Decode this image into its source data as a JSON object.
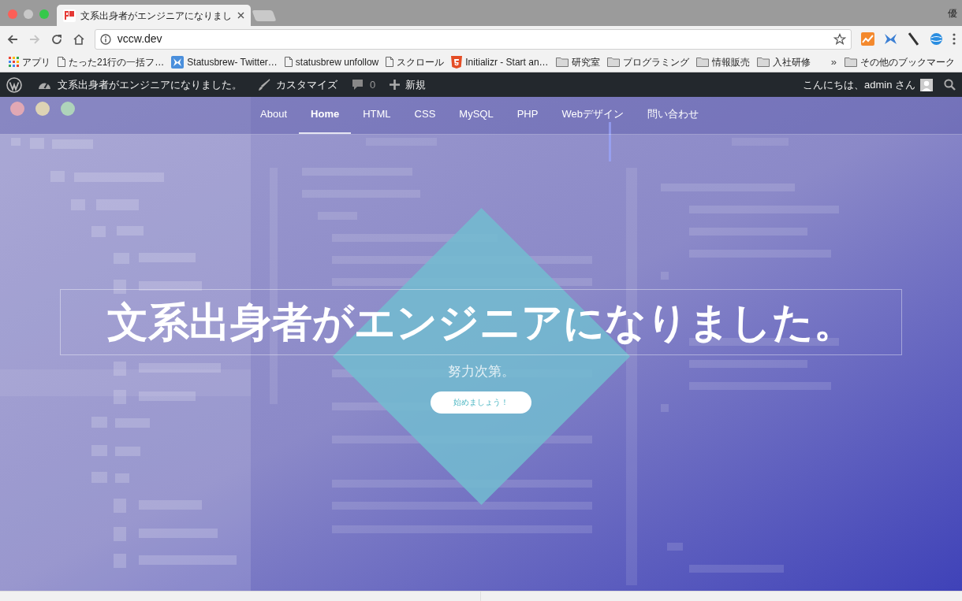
{
  "browser": {
    "tab_title": "文系出身者がエンジニアになりまし",
    "profile": "優",
    "url": "vccw.dev",
    "bookmarks": [
      {
        "label": "アプリ",
        "kind": "apps"
      },
      {
        "label": "たった21行の一括フ…",
        "kind": "page"
      },
      {
        "label": "Statusbrew- Twitter…",
        "kind": "app"
      },
      {
        "label": "statusbrew unfollow",
        "kind": "page"
      },
      {
        "label": "スクロール",
        "kind": "page"
      },
      {
        "label": "Initializr - Start an…",
        "kind": "html5"
      },
      {
        "label": "研究室",
        "kind": "folder"
      },
      {
        "label": "プログラミング",
        "kind": "folder"
      },
      {
        "label": "情報販売",
        "kind": "folder"
      },
      {
        "label": "入社研修",
        "kind": "folder"
      }
    ],
    "overflow": "»",
    "other_bookmarks": "その他のブックマーク"
  },
  "admin_bar": {
    "site_title": "文系出身者がエンジニアになりました。",
    "customize": "カスタマイズ",
    "comments": "0",
    "new": "新規",
    "greeting": "こんにちは、admin さん"
  },
  "hero": {
    "nav": [
      {
        "label": "About",
        "selected": false
      },
      {
        "label": "Home",
        "selected": true
      },
      {
        "label": "HTML",
        "selected": false
      },
      {
        "label": "CSS",
        "selected": false
      },
      {
        "label": "MySQL",
        "selected": false
      },
      {
        "label": "PHP",
        "selected": false
      },
      {
        "label": "Webデザイン",
        "selected": false
      },
      {
        "label": "問い合わせ",
        "selected": false
      }
    ],
    "title": "文系出身者がエンジニアになりました。",
    "subtitle": "努力次第。",
    "button": "始めましょう！"
  }
}
